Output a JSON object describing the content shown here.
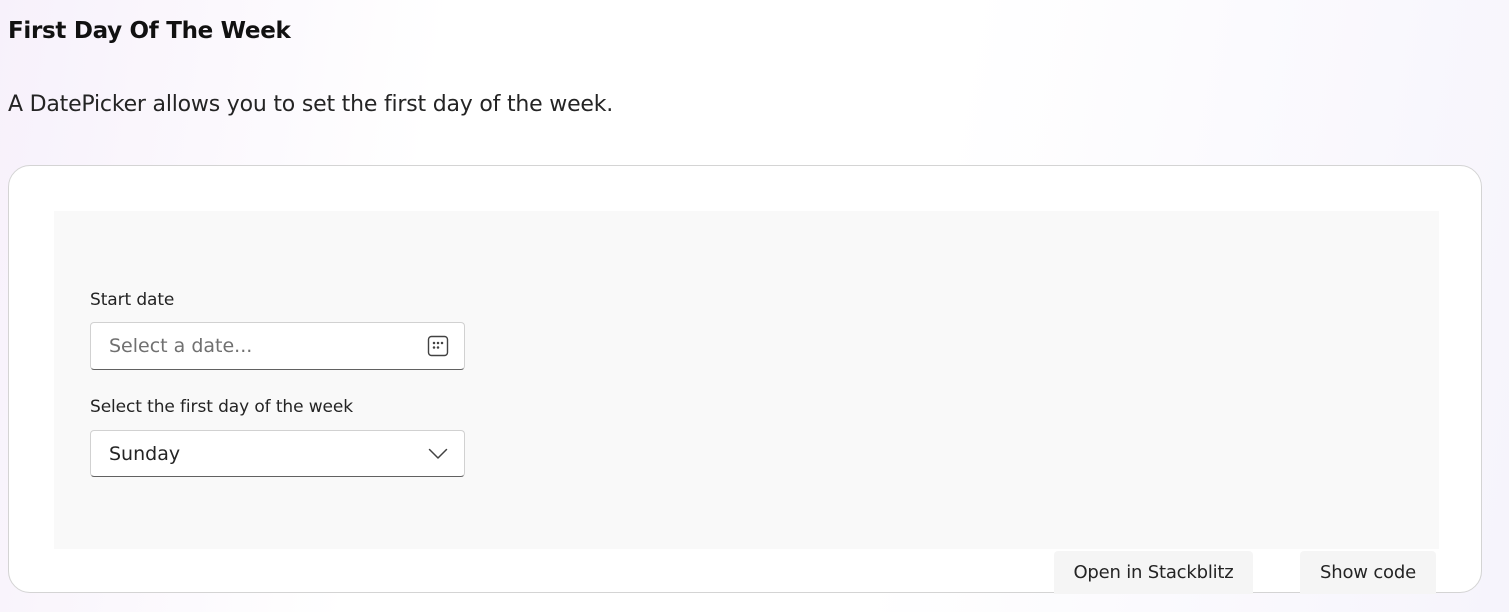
{
  "section": {
    "title": "First Day Of The Week",
    "description": "A DatePicker allows you to set the first day of the week."
  },
  "example": {
    "start_date": {
      "label": "Start date",
      "placeholder": "Select a date...",
      "value": "",
      "icon": "calendar-icon"
    },
    "first_day": {
      "label": "Select the first day of the week",
      "selected": "Sunday",
      "icon": "chevron-down-icon"
    }
  },
  "actions": {
    "open_stackblitz": "Open in Stackblitz",
    "show_code": "Show code"
  }
}
